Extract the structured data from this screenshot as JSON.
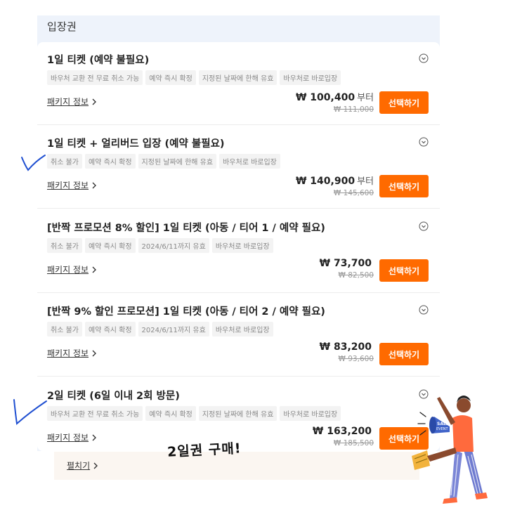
{
  "section": {
    "title": "입장권"
  },
  "items": [
    {
      "title": "1일 티켓 (예약 불필요)",
      "tags": [
        "바우처 교환 전 무료 취소 가능",
        "예약 즉시 확정",
        "지정된 날짜에 한해 유효",
        "바우처로 바로입장"
      ],
      "package_label": "패키지 정보",
      "price": "₩ 100,400",
      "price_suffix": "부터",
      "original_price": "₩ 111,000",
      "button": "선택하기"
    },
    {
      "title": "1일 티켓 + 얼리버드 입장 (예약 불필요)",
      "tags": [
        "취소 불가",
        "예약 즉시 확정",
        "지정된 날짜에 한해 유효",
        "바우처로 바로입장"
      ],
      "package_label": "패키지 정보",
      "price": "₩ 140,900",
      "price_suffix": "부터",
      "original_price": "₩ 145,600",
      "button": "선택하기"
    },
    {
      "title": "[반짝 프로모션 8% 할인] 1일 티켓 (아동 / 티어 1 / 예약 필요)",
      "tags": [
        "취소 불가",
        "예약 즉시 확정",
        "2024/6/11까지 유효",
        "바우처로 바로입장"
      ],
      "package_label": "패키지 정보",
      "price": "₩ 73,700",
      "price_suffix": "",
      "original_price": "₩ 82,500",
      "button": "선택하기"
    },
    {
      "title": "[반짝 9% 할인 프로모션] 1일 티켓 (아동 / 티어 2 / 예약 필요)",
      "tags": [
        "취소 불가",
        "예약 즉시 확정",
        "2024/6/11까지 유효",
        "바우처로 바로입장"
      ],
      "package_label": "패키지 정보",
      "price": "₩ 83,200",
      "price_suffix": "",
      "original_price": "₩ 93,600",
      "button": "선택하기"
    },
    {
      "title": "2일 티켓 (6일 이내 2회 방문)",
      "tags": [
        "바우처 교환 전 무료 취소 가능",
        "예약 즉시 확정",
        "지정된 날짜에 한해 유효",
        "바우처로 바로입장"
      ],
      "package_label": "패키지 정보",
      "price": "₩ 163,200",
      "price_suffix": "",
      "original_price": "₩ 185,500",
      "button": "선택하기"
    }
  ],
  "expand": {
    "label": "펼치기"
  },
  "annotation": {
    "text": "2일권 구매!"
  },
  "mascot": {
    "sign_text": "SALE",
    "sign_subtext": "EVENT"
  },
  "icons": {
    "chevron": "chevron-down-circle-icon",
    "arrow": "chevron-right-icon",
    "check": "checkmark-annotation-icon",
    "mascot": "megaphone-person-illustration"
  },
  "colors": {
    "accent": "#ff6a00",
    "panel_bg": "#eef3fb",
    "annotation_check": "#1f4fd1"
  }
}
